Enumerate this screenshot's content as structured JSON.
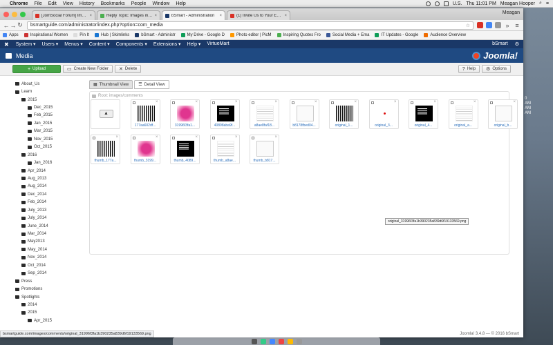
{
  "menubar": {
    "app": "Chrome",
    "items": [
      "File",
      "Edit",
      "View",
      "History",
      "Bookmarks",
      "People",
      "Window",
      "Help"
    ],
    "locale": "U.S.",
    "clock": "Thu 11:01 PM",
    "user": "Meagan Hooper"
  },
  "browser": {
    "tabs": [
      {
        "label": "[JomSocial Forum] Image",
        "color": "#d93025"
      },
      {
        "label": "Reply Topic: Images in Eve",
        "color": "#4caf50"
      },
      {
        "label": "bSmart - Administration",
        "color": "#1a3867"
      },
      {
        "label": "(1) Invite Us to Your Event",
        "color": "#d93025"
      }
    ],
    "profile": "Meagan",
    "url": "bsmartguide.com/administrator/index.php?option=com_media",
    "bookmarks": [
      {
        "label": "Apps",
        "color": "#4285f4"
      },
      {
        "label": "Inspirational Women",
        "color": "#c33"
      },
      {
        "label": "Pin It",
        "color": "#ddd"
      },
      {
        "label": "Hub | Skimlinks",
        "color": "#1976d2"
      },
      {
        "label": "bSmart - Administr",
        "color": "#1a3867"
      },
      {
        "label": "My Drive - Google D",
        "color": "#0f9d58"
      },
      {
        "label": "Photo editor | PicM",
        "color": "#ff9800"
      },
      {
        "label": "Inspiring Quotes Fro",
        "color": "#4caf50"
      },
      {
        "label": "Social Media + Ema",
        "color": "#3b5998"
      },
      {
        "label": "IT Updates - Google",
        "color": "#0f9d58"
      },
      {
        "label": "Audience Overview",
        "color": "#ef6c00"
      }
    ]
  },
  "joomla": {
    "nav": [
      "System",
      "Users",
      "Menus",
      "Content",
      "Components",
      "Extensions",
      "Help",
      "VirtueMart"
    ],
    "site_name": "bSmart",
    "page_title": "Media",
    "brand": "Joomla!",
    "toolbar": {
      "upload": "Upload",
      "new_folder": "Create New Folder",
      "delete": "Delete",
      "help": "Help",
      "options": "Options"
    },
    "view_tabs": {
      "thumbnail": "Thumbnail View",
      "detail": "Detail View"
    },
    "root_label": "Root: images/comments",
    "folder_tree": [
      {
        "label": "About_Us",
        "level": 0
      },
      {
        "label": "Learn",
        "level": 0
      },
      {
        "label": "2015",
        "level": 1
      },
      {
        "label": "Dec_2015",
        "level": 2
      },
      {
        "label": "Feb_2015",
        "level": 2
      },
      {
        "label": "Jan_2015",
        "level": 2
      },
      {
        "label": "Mar_2015",
        "level": 2
      },
      {
        "label": "Nov_2015",
        "level": 2
      },
      {
        "label": "Oct_2015",
        "level": 2
      },
      {
        "label": "2016",
        "level": 1
      },
      {
        "label": "Jan_2016",
        "level": 2
      },
      {
        "label": "Apr_2014",
        "level": 1
      },
      {
        "label": "Aug_2013",
        "level": 1
      },
      {
        "label": "Aug_2014",
        "level": 1
      },
      {
        "label": "Dec_2014",
        "level": 1
      },
      {
        "label": "Feb_2014",
        "level": 1
      },
      {
        "label": "July_2013",
        "level": 1
      },
      {
        "label": "July_2014",
        "level": 1
      },
      {
        "label": "June_2014",
        "level": 1
      },
      {
        "label": "Mar_2014",
        "level": 1
      },
      {
        "label": "May2013",
        "level": 1
      },
      {
        "label": "May_2014",
        "level": 1
      },
      {
        "label": "Nov_2014",
        "level": 1
      },
      {
        "label": "Oct_2014",
        "level": 1
      },
      {
        "label": "Sep_2014",
        "level": 1
      },
      {
        "label": "Press",
        "level": 0
      },
      {
        "label": "Promotions",
        "level": 0
      },
      {
        "label": "Spotlights",
        "level": 0
      },
      {
        "label": "2014",
        "level": 1
      },
      {
        "label": "2015",
        "level": 1
      },
      {
        "label": "Apr_2015",
        "level": 2
      }
    ],
    "thumbnails": [
      {
        "caption": "",
        "kind": "up"
      },
      {
        "caption": "177aa602df...",
        "kind": "barcode"
      },
      {
        "caption": "31996f3fa1...",
        "kind": "pink"
      },
      {
        "caption": "40898aba9f...",
        "kind": "blk"
      },
      {
        "caption": "a8ae8faf18...",
        "kind": "doc"
      },
      {
        "caption": "b8178fbed04...",
        "kind": "shot"
      },
      {
        "caption": "original_1...",
        "kind": "barcode"
      },
      {
        "caption": "original_3...",
        "kind": "dot"
      },
      {
        "caption": "original_4...",
        "kind": "blk"
      },
      {
        "caption": "original_a...",
        "kind": "doc"
      },
      {
        "caption": "original_b...",
        "kind": "shot"
      },
      {
        "caption": "thumb_177a...",
        "kind": "barcode"
      },
      {
        "caption": "thumb_3199...",
        "kind": "pink"
      },
      {
        "caption": "thumb_4089...",
        "kind": "blk"
      },
      {
        "caption": "thumb_a8ae...",
        "kind": "doc"
      },
      {
        "caption": "thumb_b817...",
        "kind": "shot"
      }
    ],
    "tooltip": "original_31996f3fa1b390235a839d6f19133569.png",
    "footer": "Joomla! 3.4.8 — © 2016 bSmart"
  },
  "status_url": "bsmartguide.com/images/comments/original_31996f3fa1b390235a839d6f19133569.png",
  "sidewin_lines": [
    "0",
    "AM",
    "AM",
    "AM"
  ]
}
